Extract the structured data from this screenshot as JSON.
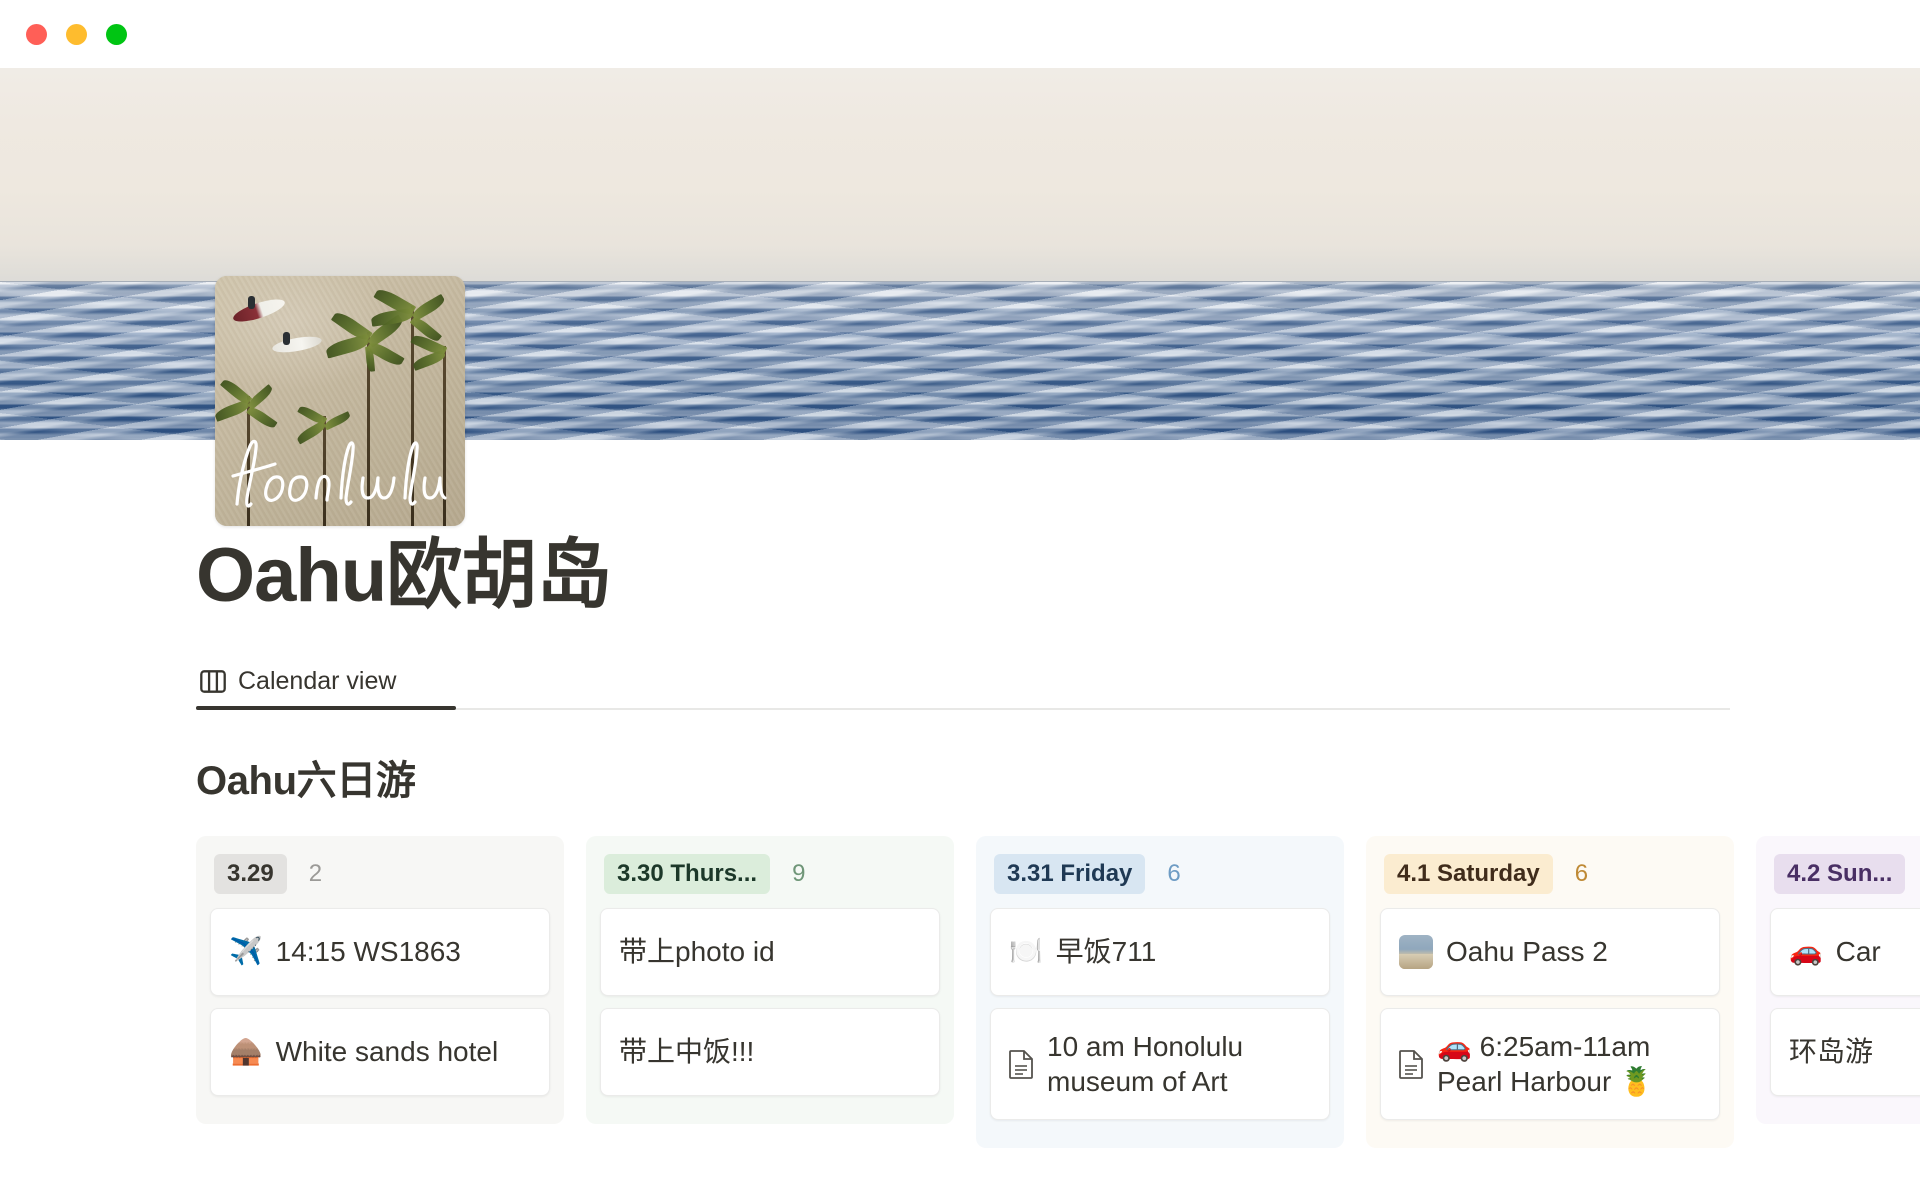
{
  "window": {
    "controls": [
      {
        "name": "close",
        "color": "#ff5f57"
      },
      {
        "name": "minimize",
        "color": "#febc2e"
      },
      {
        "name": "maximize",
        "color": "#00c513"
      }
    ]
  },
  "page": {
    "title": "Oahu欧胡岛",
    "icon_caption": "Honolulu",
    "cover_alt": "ocean-horizon-photo"
  },
  "tabs": [
    {
      "label": "Calendar view",
      "icon": "board-view-icon",
      "active": true
    }
  ],
  "board": {
    "title": "Oahu六日游",
    "columns": [
      {
        "badge": "3.29",
        "count": "2",
        "badge_bg": "#e3e2e0",
        "badge_color": "#37352f",
        "count_color": "#9b9a97",
        "column_bg": "#f7f7f5",
        "cards": [
          {
            "icon": "✈️",
            "icon_type": "emoji",
            "text": "14:15 WS1863"
          },
          {
            "icon": "🛖",
            "icon_type": "emoji",
            "text": "White sands hotel"
          }
        ]
      },
      {
        "badge": "3.30 Thurs...",
        "count": "9",
        "badge_bg": "#dbeddb",
        "badge_color": "#1c3829",
        "count_color": "#6f9678",
        "column_bg": "#f5f9f5",
        "cards": [
          {
            "icon": "",
            "icon_type": "none",
            "text": "带上photo id"
          },
          {
            "icon": "",
            "icon_type": "none",
            "text": "带上中饭!!!"
          }
        ]
      },
      {
        "badge": "3.31 Friday",
        "count": "6",
        "badge_bg": "#d8e6f2",
        "badge_color": "#1f3954",
        "count_color": "#6e9cc4",
        "column_bg": "#f4f8fb",
        "cards": [
          {
            "icon": "🍽️",
            "icon_type": "emoji",
            "text": "早饭711"
          },
          {
            "icon": "",
            "icon_type": "doc",
            "text": "10 am Honolulu museum of Art"
          }
        ]
      },
      {
        "badge": "4.1 Saturday",
        "count": "6",
        "badge_bg": "#fbecd0",
        "badge_color": "#402c1b",
        "count_color": "#bf8a36",
        "column_bg": "#fdfaf4",
        "cards": [
          {
            "icon": "",
            "icon_type": "thumb",
            "text": "Oahu Pass 2"
          },
          {
            "icon": "",
            "icon_type": "doc",
            "text": "🚗 6:25am-11am Pearl Harbour 🍍"
          }
        ]
      },
      {
        "badge": "4.2 Sun...",
        "count": "",
        "badge_bg": "#e8deee",
        "badge_color": "#492f64",
        "count_color": "#8d6eb0",
        "column_bg": "#faf7fc",
        "cards": [
          {
            "icon": "🚗",
            "icon_type": "emoji",
            "text": "Car"
          },
          {
            "icon": "",
            "icon_type": "none",
            "text": "环岛游"
          }
        ]
      }
    ]
  }
}
